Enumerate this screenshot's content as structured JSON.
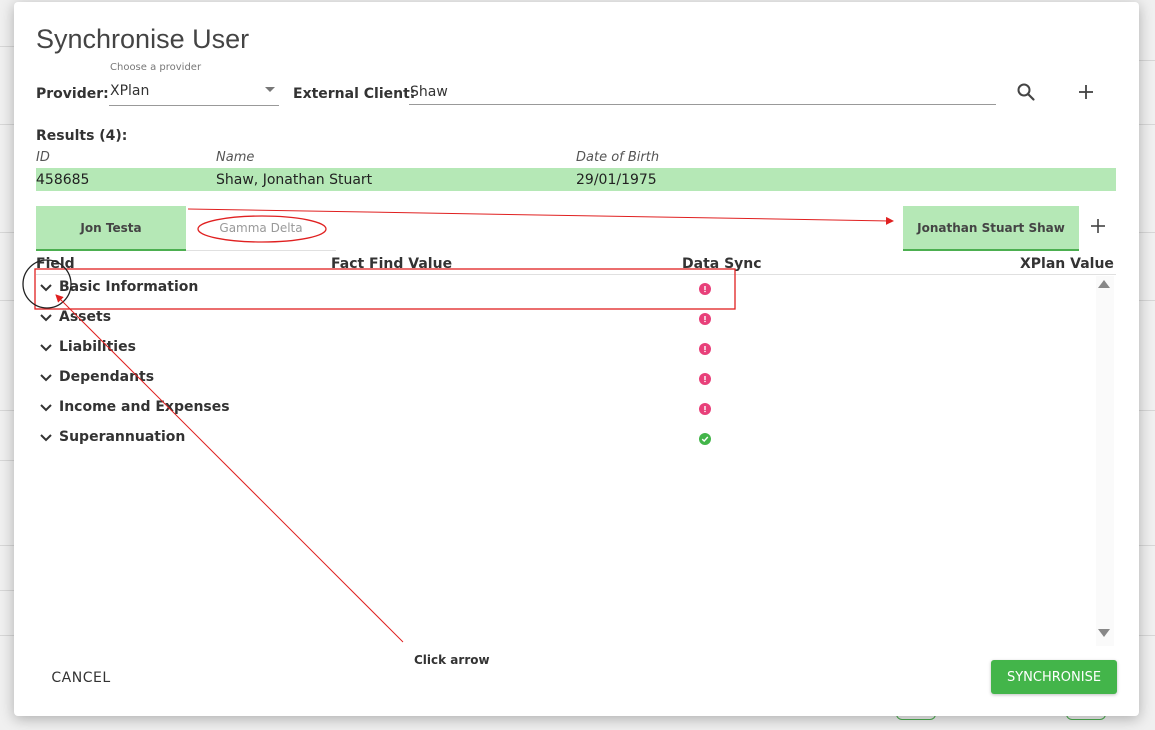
{
  "dialog": {
    "title": "Synchronise User"
  },
  "provider": {
    "label": "Provider:",
    "hint": "Choose a provider",
    "value": "XPlan"
  },
  "external_client": {
    "label": "External Client:",
    "value": "Shaw"
  },
  "icons": {
    "search": "search-icon",
    "add": "plus-icon"
  },
  "results": {
    "label": "Results (4):",
    "columns": [
      "ID",
      "Name",
      "Date of Birth"
    ],
    "rows": [
      {
        "id": "458685",
        "name": "Shaw, Jonathan Stuart",
        "dob": "29/01/1975"
      }
    ]
  },
  "tabs": {
    "left": [
      "Jon Testa",
      "Gamma Delta"
    ],
    "right": "Jonathan Stuart Shaw",
    "add": "+"
  },
  "table": {
    "headers": [
      "Field",
      "Fact Find Value",
      "Data Sync",
      "XPlan Value"
    ],
    "sections": [
      {
        "label": "Basic Information",
        "status": "error"
      },
      {
        "label": "Assets",
        "status": "error"
      },
      {
        "label": "Liabilities",
        "status": "error"
      },
      {
        "label": "Dependants",
        "status": "error"
      },
      {
        "label": "Income and Expenses",
        "status": "error"
      },
      {
        "label": "Superannuation",
        "status": "ok"
      }
    ]
  },
  "footer": {
    "cancel": "CANCEL",
    "synchronise": "SYNCHRONISE"
  },
  "annotation": {
    "text": "Click arrow"
  },
  "colors": {
    "accent_green": "#43b54a",
    "highlight_green": "#b5e8b6",
    "error_pink": "#e8407a",
    "annotation_red": "#e02020"
  }
}
